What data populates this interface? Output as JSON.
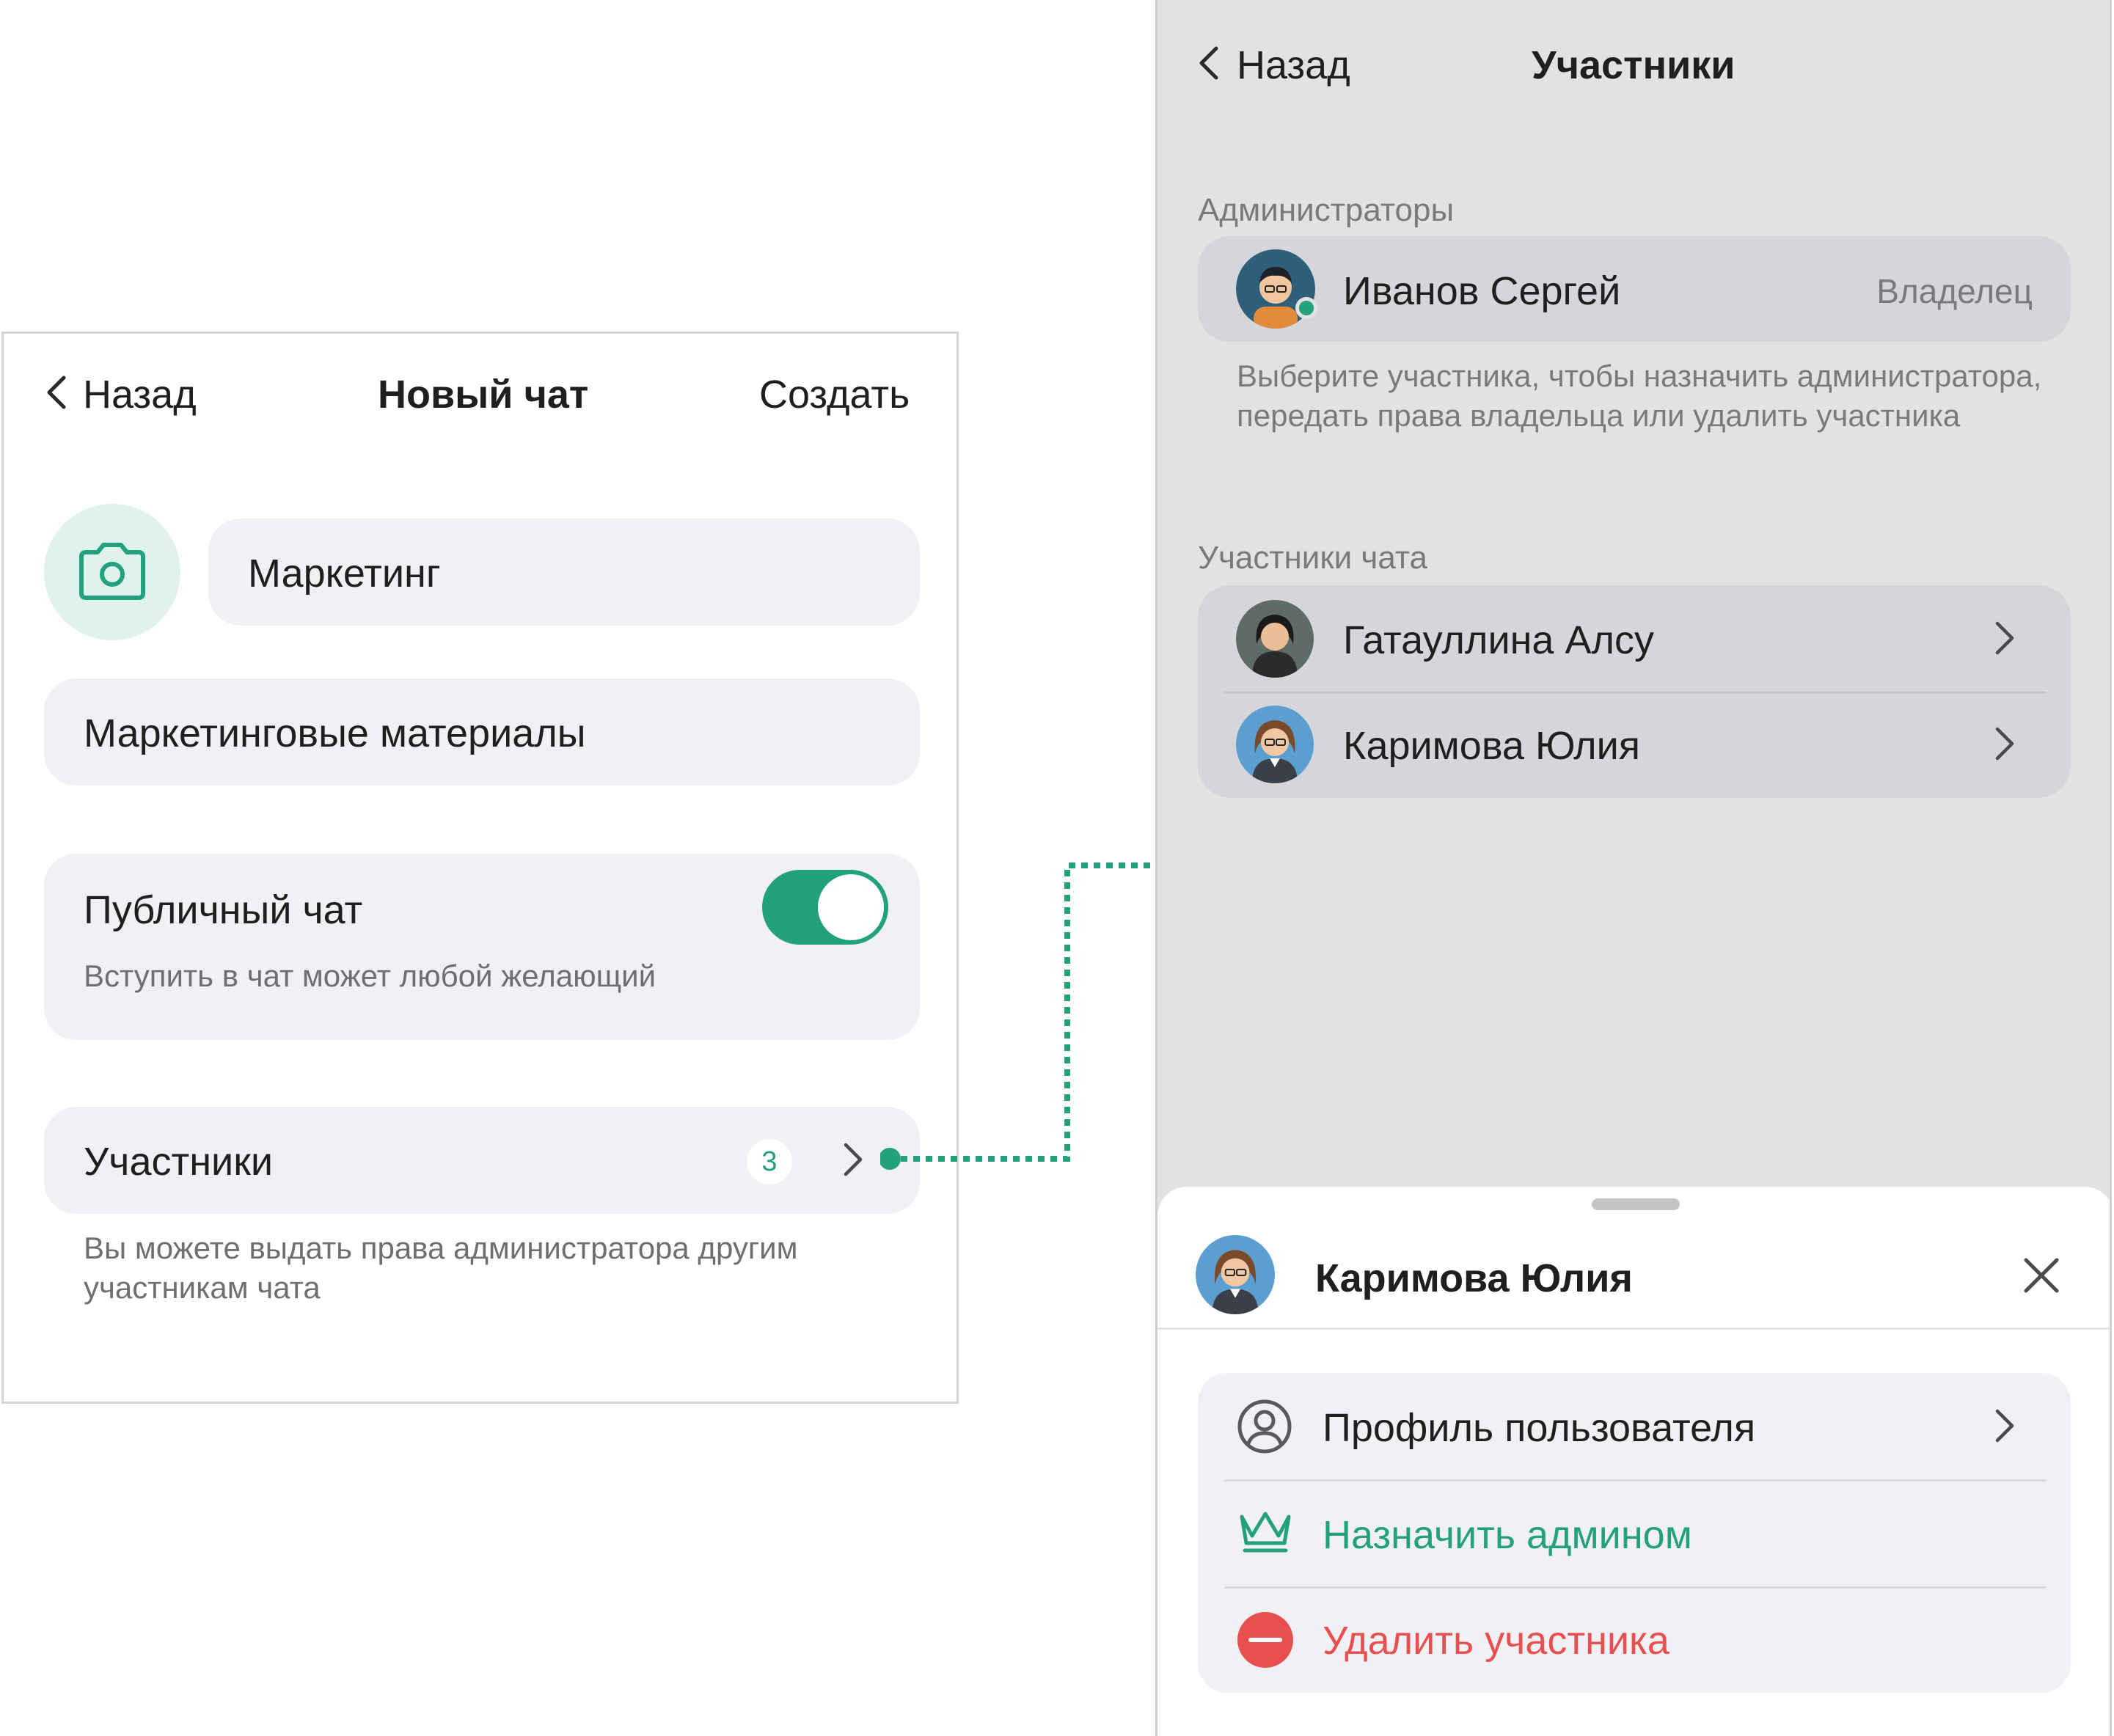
{
  "left_screen": {
    "nav": {
      "back_label": "Назад",
      "title": "Новый чат",
      "create_label": "Создать"
    },
    "chat_name_value": "Маркетинг",
    "description_value": "Маркетинговые материалы",
    "public_chat": {
      "label": "Публичный чат",
      "hint": "Вступить в чат может любой желающий",
      "enabled": true
    },
    "participants": {
      "label": "Участники",
      "count": "3",
      "hint": "Вы можете выдать права администратора другим участникам чата"
    },
    "icons": {
      "camera": "camera-icon",
      "back": "chevron-left-icon",
      "chevron": "chevron-right-icon"
    }
  },
  "right_screen": {
    "nav": {
      "back_label": "Назад",
      "title": "Участники"
    },
    "admins": {
      "section_label": "Администраторы",
      "items": [
        {
          "name": "Иванов Сергей",
          "role": "Владелец",
          "online": true
        }
      ],
      "hint": "Выберите участника, чтобы назначить администратора, передать права владельца или удалить участника"
    },
    "members": {
      "section_label": "Участники чата",
      "items": [
        {
          "name": "Гатауллина Алсу"
        },
        {
          "name": "Каримова Юлия"
        }
      ]
    },
    "sheet": {
      "user_name": "Каримова Юлия",
      "actions": [
        {
          "label": "Профиль пользователя",
          "icon": "user-circle-icon",
          "color": "#1f1f1f"
        },
        {
          "label": "Назначить админом",
          "icon": "crown-icon",
          "color": "#23a07c"
        },
        {
          "label": "Удалить участника",
          "icon": "minus-circle-icon",
          "color": "#e8504f"
        }
      ]
    }
  },
  "colors": {
    "accent": "#23a07c",
    "danger": "#e8504f",
    "muted": "#6e6e73"
  }
}
